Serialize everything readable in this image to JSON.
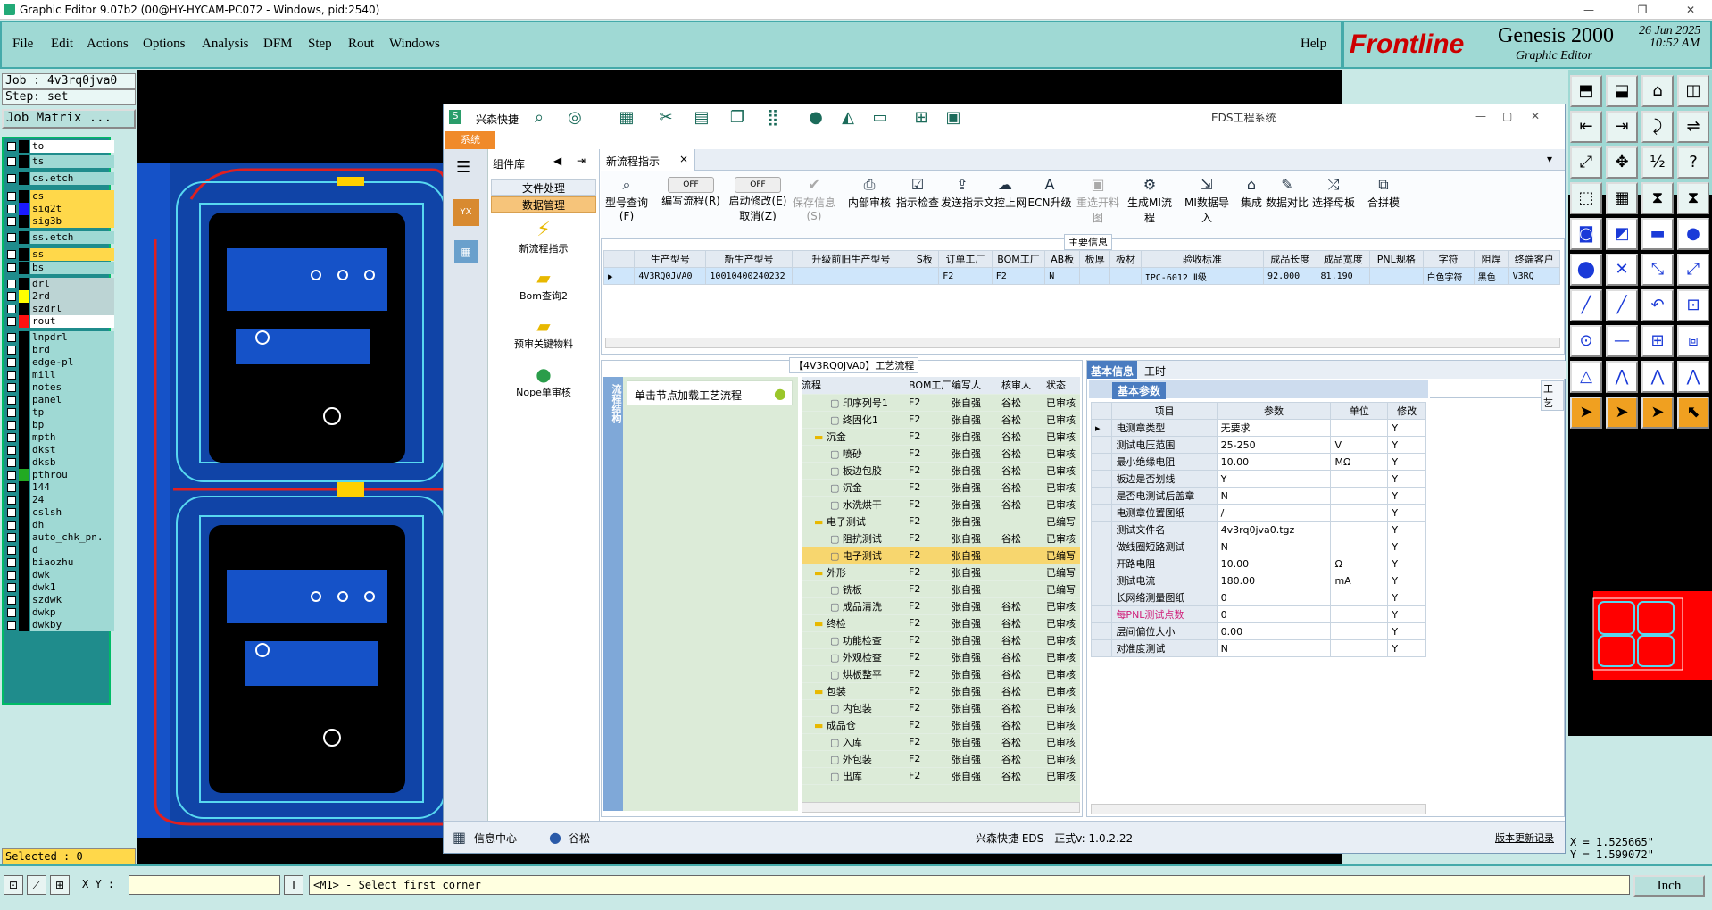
{
  "window": {
    "title": "Graphic Editor 9.07b2 (00@HY-HYCAM-PC072 - Windows, pid:2540)",
    "controls": [
      "—",
      "❐",
      "✕"
    ]
  },
  "menubar": {
    "items": [
      "File",
      "Edit",
      "Actions",
      "Options",
      "Analysis",
      "DFM",
      "Step",
      "Rout",
      "Windows"
    ],
    "help": "Help"
  },
  "brand": {
    "logo": "Frontline",
    "product": "Genesis 2000",
    "subtitle": "Graphic Editor",
    "date": "26 Jun 2025",
    "time": "10:52 AM"
  },
  "job": {
    "job_label": "Job : 4v3rq0jva0",
    "step_label": "Step: set",
    "matrix_button": "Job Matrix ..."
  },
  "layers": [
    {
      "name": "to",
      "color": "#ffffff",
      "sw": "#000000"
    },
    {
      "name": "ts",
      "color": "#9fd9d4",
      "sw": "#000000"
    },
    {
      "name": "cs.etch",
      "color": "#9fd9d4",
      "sw": "#000000"
    },
    {
      "name": "cs",
      "color": "#ffd84a",
      "sw": "#000000"
    },
    {
      "name": "sig2t",
      "color": "#ffd84a",
      "sw": "#1a1aff"
    },
    {
      "name": "sig3b",
      "color": "#ffd84a",
      "sw": "#000000"
    },
    {
      "name": "ss.etch",
      "color": "#9fd9d4",
      "sw": "#000000"
    },
    {
      "name": "ss",
      "color": "#ffd84a",
      "sw": "#000000"
    },
    {
      "name": "bs",
      "color": "#9fd9d4",
      "sw": "#000000"
    },
    {
      "name": "drl",
      "color": "#bcd4d4",
      "sw": "#000000"
    },
    {
      "name": "2rd",
      "color": "#bcd4d4",
      "sw": "#ffff00"
    },
    {
      "name": "szdrl",
      "color": "#bcd4d4",
      "sw": "#000000"
    },
    {
      "name": "rout",
      "color": "#ffffff",
      "sw": "#ff1010"
    },
    {
      "name": "lnpdrl",
      "color": "#9fd9d4",
      "sw": "#000000"
    },
    {
      "name": "brd",
      "color": "#9fd9d4",
      "sw": "#000000"
    },
    {
      "name": "edge-pl",
      "color": "#9fd9d4",
      "sw": "#000000"
    },
    {
      "name": "mill",
      "color": "#9fd9d4",
      "sw": "#000000"
    },
    {
      "name": "notes",
      "color": "#9fd9d4",
      "sw": "#000000"
    },
    {
      "name": "panel",
      "color": "#9fd9d4",
      "sw": "#000000"
    },
    {
      "name": "tp",
      "color": "#9fd9d4",
      "sw": "#000000"
    },
    {
      "name": "bp",
      "color": "#9fd9d4",
      "sw": "#000000"
    },
    {
      "name": "mpth",
      "color": "#9fd9d4",
      "sw": "#000000"
    },
    {
      "name": "dkst",
      "color": "#9fd9d4",
      "sw": "#000000"
    },
    {
      "name": "dksb",
      "color": "#9fd9d4",
      "sw": "#000000"
    },
    {
      "name": "pthrou",
      "color": "#9fd9d4",
      "sw": "#22aa22"
    },
    {
      "name": "144",
      "color": "#9fd9d4",
      "sw": "#000000"
    },
    {
      "name": "24",
      "color": "#9fd9d4",
      "sw": "#000000"
    },
    {
      "name": "cslsh",
      "color": "#9fd9d4",
      "sw": "#000000"
    },
    {
      "name": "dh",
      "color": "#9fd9d4",
      "sw": "#000000"
    },
    {
      "name": "auto_chk_pn.",
      "color": "#9fd9d4",
      "sw": "#000000"
    },
    {
      "name": "d",
      "color": "#9fd9d4",
      "sw": "#000000"
    },
    {
      "name": "biaozhu",
      "color": "#9fd9d4",
      "sw": "#000000"
    },
    {
      "name": "dwk",
      "color": "#9fd9d4",
      "sw": "#000000"
    },
    {
      "name": "dwk1",
      "color": "#9fd9d4",
      "sw": "#000000"
    },
    {
      "name": "szdwk",
      "color": "#9fd9d4",
      "sw": "#000000"
    },
    {
      "name": "dwkp",
      "color": "#9fd9d4",
      "sw": "#000000"
    },
    {
      "name": "dwkby",
      "color": "#9fd9d4",
      "sw": "#000000"
    }
  ],
  "selected": "Selected : 0",
  "coords": {
    "x": "X = 1.525665\"",
    "y": "Y = 1.599072\""
  },
  "status": {
    "xy_label": "X Y :",
    "xy_value": "",
    "message": "<M1> - Select first corner",
    "unit": "Inch"
  },
  "eds": {
    "app_name": "兴森快捷",
    "window_title": "EDS工程系统",
    "system_tab": "系统",
    "lib_title": "组件库",
    "lib_sections": [
      "文件处理",
      "数据管理"
    ],
    "lib_items": [
      "新流程指示",
      "Bom查询2",
      "预审关键物料",
      "Nope单审核"
    ],
    "doc_tab": "新流程指示",
    "ribbon": [
      {
        "label": "型号查询(F)"
      },
      {
        "label": "编写流程(R)",
        "toggle": "OFF"
      },
      {
        "label": "启动修改(E)",
        "sub": "取消(Z)",
        "toggle": "OFF"
      },
      {
        "label": "保存信息(S)"
      },
      {
        "label": "内部审核"
      },
      {
        "label": "指示检查"
      },
      {
        "label": "发送指示"
      },
      {
        "label": "文控上网"
      },
      {
        "label": "ECN升级"
      },
      {
        "label": "重选开料图"
      },
      {
        "label": "生成MI流程"
      },
      {
        "label": "MI数据导入"
      },
      {
        "label": "集成"
      },
      {
        "label": "数据对比"
      },
      {
        "label": "选择母板"
      },
      {
        "label": "合拼模"
      }
    ],
    "main_info_title": "主要信息",
    "main_cols": [
      "生产型号",
      "新生产型号",
      "升级前旧生产型号",
      "S板",
      "订单工厂",
      "BOM工厂",
      "AB板",
      "板厚",
      "板材",
      "验收标准",
      "成品长度",
      "成品宽度",
      "PNL规格",
      "字符",
      "阻焊",
      "终端客户"
    ],
    "main_row": [
      "4V3RQ0JVA0",
      "10010400240232",
      "",
      "",
      "F2",
      "F2",
      "N",
      "",
      "",
      "IPC-6012 Ⅱ级",
      "92.000",
      "81.190",
      "",
      "白色字符",
      "黑色",
      "V3RQ"
    ],
    "flow_title": "【4V3RQ0JVA0】工艺流程",
    "flow_side_label": "流程结构",
    "flow_hint": "单击节点加载工艺流程",
    "flow_cols": [
      "流程",
      "BOM工厂",
      "编写人",
      "核审人",
      "状态"
    ],
    "flow_rows": [
      {
        "lvl": 2,
        "name": "印序列号1",
        "bom": "F2",
        "w": "张自强",
        "r": "谷松",
        "s": "已审核"
      },
      {
        "lvl": 2,
        "name": "终固化1",
        "bom": "F2",
        "w": "张自强",
        "r": "谷松",
        "s": "已审核"
      },
      {
        "lvl": 1,
        "name": "沉金",
        "bom": "F2",
        "w": "张自强",
        "r": "谷松",
        "s": "已审核"
      },
      {
        "lvl": 2,
        "name": "喷砂",
        "bom": "F2",
        "w": "张自强",
        "r": "谷松",
        "s": "已审核"
      },
      {
        "lvl": 2,
        "name": "板边包胶",
        "bom": "F2",
        "w": "张自强",
        "r": "谷松",
        "s": "已审核"
      },
      {
        "lvl": 2,
        "name": "沉金",
        "bom": "F2",
        "w": "张自强",
        "r": "谷松",
        "s": "已审核"
      },
      {
        "lvl": 2,
        "name": "水洗烘干",
        "bom": "F2",
        "w": "张自强",
        "r": "谷松",
        "s": "已审核"
      },
      {
        "lvl": 1,
        "name": "电子测试",
        "bom": "F2",
        "w": "张自强",
        "r": "",
        "s": "已编写"
      },
      {
        "lvl": 2,
        "name": "阻抗测试",
        "bom": "F2",
        "w": "张自强",
        "r": "谷松",
        "s": "已审核"
      },
      {
        "lvl": 2,
        "name": "电子测试",
        "bom": "F2",
        "w": "张自强",
        "r": "",
        "s": "已编写",
        "sel": true
      },
      {
        "lvl": 1,
        "name": "外形",
        "bom": "F2",
        "w": "张自强",
        "r": "",
        "s": "已编写"
      },
      {
        "lvl": 2,
        "name": "铣板",
        "bom": "F2",
        "w": "张自强",
        "r": "",
        "s": "已编写"
      },
      {
        "lvl": 2,
        "name": "成品清洗",
        "bom": "F2",
        "w": "张自强",
        "r": "谷松",
        "s": "已审核"
      },
      {
        "lvl": 1,
        "name": "终检",
        "bom": "F2",
        "w": "张自强",
        "r": "谷松",
        "s": "已审核"
      },
      {
        "lvl": 2,
        "name": "功能检查",
        "bom": "F2",
        "w": "张自强",
        "r": "谷松",
        "s": "已审核"
      },
      {
        "lvl": 2,
        "name": "外观检查",
        "bom": "F2",
        "w": "张自强",
        "r": "谷松",
        "s": "已审核"
      },
      {
        "lvl": 2,
        "name": "烘板整平",
        "bom": "F2",
        "w": "张自强",
        "r": "谷松",
        "s": "已审核"
      },
      {
        "lvl": 1,
        "name": "包装",
        "bom": "F2",
        "w": "张自强",
        "r": "谷松",
        "s": "已审核"
      },
      {
        "lvl": 2,
        "name": "内包装",
        "bom": "F2",
        "w": "张自强",
        "r": "谷松",
        "s": "已审核"
      },
      {
        "lvl": 1,
        "name": "成品仓",
        "bom": "F2",
        "w": "张自强",
        "r": "谷松",
        "s": "已审核"
      },
      {
        "lvl": 2,
        "name": "入库",
        "bom": "F2",
        "w": "张自强",
        "r": "谷松",
        "s": "已审核"
      },
      {
        "lvl": 2,
        "name": "外包装",
        "bom": "F2",
        "w": "张自强",
        "r": "谷松",
        "s": "已审核"
      },
      {
        "lvl": 2,
        "name": "出库",
        "bom": "F2",
        "w": "张自强",
        "r": "谷松",
        "s": "已审核"
      }
    ],
    "info_tabs": [
      "基本信息",
      "工时"
    ],
    "info_subtab": "基本参数",
    "side_tab": "工艺",
    "param_cols": [
      "项目",
      "参数",
      "单位",
      "修改"
    ],
    "params": [
      {
        "k": "电测章类型",
        "v": "无要求",
        "u": "",
        "m": "Y"
      },
      {
        "k": "测试电压范围",
        "v": "25-250",
        "u": "V",
        "m": "Y"
      },
      {
        "k": "最小绝缘电阻",
        "v": "10.00",
        "u": "MΩ",
        "m": "Y"
      },
      {
        "k": "板边是否划线",
        "v": "Y",
        "u": "",
        "m": "Y"
      },
      {
        "k": "是否电测试后盖章",
        "v": "N",
        "u": "",
        "m": "Y"
      },
      {
        "k": "电测章位置图纸",
        "v": "/",
        "u": "",
        "m": "Y"
      },
      {
        "k": "测试文件名",
        "v": "4v3rq0jva0.tgz",
        "u": "",
        "m": "Y"
      },
      {
        "k": "做线圈短路测试",
        "v": "N",
        "u": "",
        "m": "Y"
      },
      {
        "k": "开路电阻",
        "v": "10.00",
        "u": "Ω",
        "m": "Y"
      },
      {
        "k": "测试电流",
        "v": "180.00",
        "u": "mA",
        "m": "Y"
      },
      {
        "k": "长网络测量图纸",
        "v": "0",
        "u": "",
        "m": "Y"
      },
      {
        "k": "每PNL测试点数",
        "v": "0",
        "u": "",
        "m": "Y",
        "pink": true
      },
      {
        "k": "层间偏位大小",
        "v": "0.00",
        "u": "",
        "m": "Y"
      },
      {
        "k": "对准度测试",
        "v": "N",
        "u": "",
        "m": "Y"
      }
    ],
    "footer": {
      "info_center": "信息中心",
      "user": "谷松",
      "version": "兴森快捷 EDS - 正式v: 1.0.2.22",
      "update_link": "版本更新记录"
    }
  }
}
